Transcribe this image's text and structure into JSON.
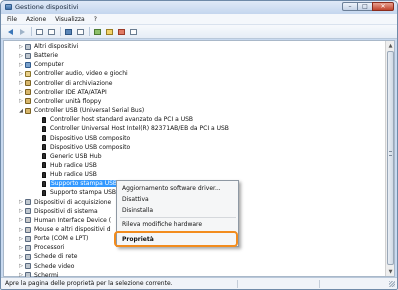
{
  "window": {
    "title": "Gestione dispositivi"
  },
  "menubar": {
    "items": [
      "File",
      "Azione",
      "Visualizza",
      "?"
    ]
  },
  "tree": {
    "rows": [
      {
        "label": "Altri dispositivi",
        "expander": "▷",
        "icon": "unknown-device-icon"
      },
      {
        "label": "Batterie",
        "expander": "▷",
        "icon": "battery-icon"
      },
      {
        "label": "Computer",
        "expander": "▷",
        "icon": "computer-icon"
      },
      {
        "label": "Controller audio, video e giochi",
        "expander": "▷",
        "icon": "sound-icon"
      },
      {
        "label": "Controller di archiviazione",
        "expander": "▷",
        "icon": "storage-controller-icon"
      },
      {
        "label": "Controller IDE ATA/ATAPI",
        "expander": "▷",
        "icon": "ide-controller-icon"
      },
      {
        "label": "Controller unità floppy",
        "expander": "▷",
        "icon": "floppy-controller-icon"
      },
      {
        "label": "Controller USB (Universal Serial Bus)",
        "expander": "◢",
        "icon": "usb-controller-icon"
      },
      {
        "label": "Controller host standard avanzato da PCI a USB",
        "expander": "",
        "icon": "usb-plug-icon"
      },
      {
        "label": "Controller Universal Host Intel(R) 82371AB/EB da PCI a USB",
        "expander": "",
        "icon": "usb-plug-icon"
      },
      {
        "label": "Dispositivo USB composito",
        "expander": "",
        "icon": "usb-plug-icon"
      },
      {
        "label": "Dispositivo USB composito",
        "expander": "",
        "icon": "usb-plug-icon"
      },
      {
        "label": "Generic USB Hub",
        "expander": "",
        "icon": "usb-plug-icon"
      },
      {
        "label": "Hub radice USB",
        "expander": "",
        "icon": "usb-plug-icon"
      },
      {
        "label": "Hub radice USB",
        "expander": "",
        "icon": "usb-plug-icon"
      },
      {
        "label": "Supporto stampa USB",
        "expander": "",
        "icon": "usb-plug-icon",
        "selected": true
      },
      {
        "label": "Supporto stampa USB",
        "expander": "",
        "icon": "usb-plug-icon"
      },
      {
        "label": "Dispositivi di acquisizione",
        "expander": "▷",
        "icon": "imaging-icon"
      },
      {
        "label": "Dispositivi di sistema",
        "expander": "▷",
        "icon": "system-device-icon"
      },
      {
        "label": "Human Interface Device (",
        "expander": "▷",
        "icon": "hid-icon"
      },
      {
        "label": "Mouse e altri dispositivi d",
        "expander": "▷",
        "icon": "mouse-icon"
      },
      {
        "label": "Porte (COM e LPT)",
        "expander": "▷",
        "icon": "port-icon"
      },
      {
        "label": "Processori",
        "expander": "▷",
        "icon": "processor-icon"
      },
      {
        "label": "Schede di rete",
        "expander": "▷",
        "icon": "network-icon"
      },
      {
        "label": "Schede video",
        "expander": "▷",
        "icon": "display-adapter-icon"
      },
      {
        "label": "Schermi",
        "expander": "▷",
        "icon": "monitor-icon"
      }
    ]
  },
  "context_menu": {
    "items": [
      "Aggiornamento software driver...",
      "Disattiva",
      "Disinstalla",
      "Rileva modifiche hardware",
      "Proprietà"
    ],
    "highlighted": "Proprietà",
    "highlight_color": "#f28c1e"
  },
  "statusbar": {
    "text": "Apre la pagina delle proprietà per la selezione corrente."
  }
}
